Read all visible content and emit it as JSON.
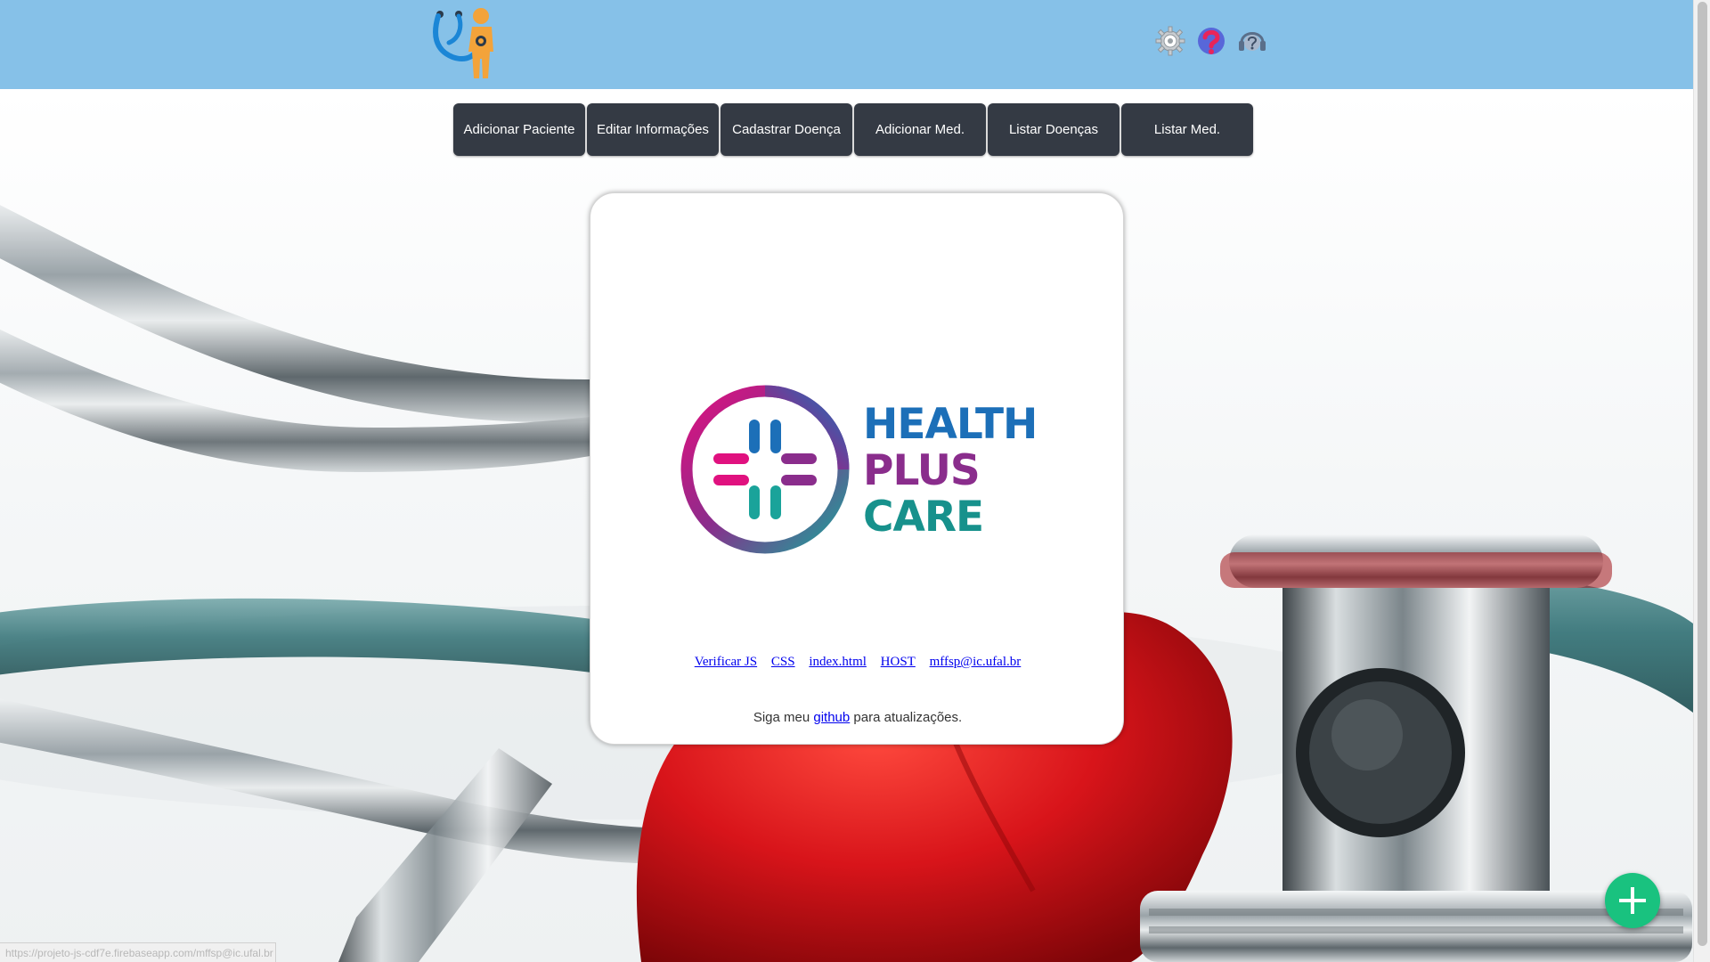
{
  "header": {
    "icons": [
      "stethoscope-doctor-logo-icon",
      "settings-gear-icon",
      "help-question-icon",
      "support-headset-question-icon"
    ],
    "colors": {
      "background": "#86c1e8"
    }
  },
  "nav": {
    "buttons": [
      "Adicionar Paciente",
      "Editar Informações",
      "Cadastrar Doença",
      "Adicionar Med.",
      "Listar Doenças",
      "Listar Med."
    ],
    "colors": {
      "background": "#343a44",
      "text": "#ffffff"
    }
  },
  "card": {
    "brand": {
      "line1": "HEALTH",
      "line2": "PLUS",
      "line3": "CARE"
    },
    "links": [
      "Verificar JS",
      "CSS",
      "index.html",
      "HOST",
      "mffsp@ic.ufal.br"
    ],
    "follow": {
      "prefix": "Siga meu",
      "link": "github",
      "suffix": "para atualizações."
    }
  },
  "fab": {
    "icon": "plus-icon",
    "color": "#19c27f"
  },
  "status_bar": {
    "url": "https://projeto-js-cdf7e.firebaseapp.com/mffsp@ic.ufal.br"
  }
}
